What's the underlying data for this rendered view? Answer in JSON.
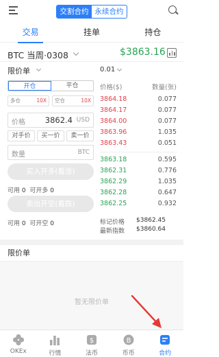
{
  "header": {
    "tab_active": "交割合约",
    "tab_inactive": "永续合约"
  },
  "main_tabs": [
    "交易",
    "挂单",
    "持仓"
  ],
  "instrument": {
    "pair": "BTC 当周·0308",
    "last_price": "$3863.16"
  },
  "order_form": {
    "order_type": "限价单",
    "side_open": "开仓",
    "side_close": "平仓",
    "long_lev_label": "多仓",
    "long_lev_value": "10X",
    "short_lev_label": "空仓",
    "short_lev_value": "10X",
    "price_label": "价格",
    "price_value": "3862.4",
    "price_unit": "USD",
    "quick": [
      "对手价",
      "买一价",
      "卖一价"
    ],
    "qty_label": "数量",
    "qty_unit": "BTC",
    "buy_button": "买入开多(看涨)",
    "sell_button": "卖出开空(看跌)",
    "avail_label": "可用",
    "avail_value": "0",
    "can_long_label": "可开多",
    "can_long_value": "0",
    "can_short_label": "可开空",
    "can_short_value": "0"
  },
  "orderbook": {
    "depth": "0.01",
    "price_header": "价格($)",
    "qty_header": "数量(张)",
    "asks": [
      {
        "price": "3864.18",
        "qty": "0.077"
      },
      {
        "price": "3864.17",
        "qty": "0.077"
      },
      {
        "price": "3864.00",
        "qty": "0.077"
      },
      {
        "price": "3863.96",
        "qty": "1.035"
      },
      {
        "price": "3863.43",
        "qty": "0.051"
      }
    ],
    "bids": [
      {
        "price": "3863.18",
        "qty": "0.595"
      },
      {
        "price": "3862.31",
        "qty": "0.776"
      },
      {
        "price": "3862.29",
        "qty": "1.035"
      },
      {
        "price": "3862.28",
        "qty": "0.647"
      },
      {
        "price": "3862.25",
        "qty": "0.932"
      }
    ],
    "mark_label": "标记价格",
    "mark_value": "$3862.45",
    "index_label": "最新指数",
    "index_value": "$3860.64"
  },
  "limit_section": {
    "title": "限价单",
    "empty": "暂无限价单"
  },
  "bottom_nav": [
    {
      "label": "OKEx",
      "icon": "okex-logo-icon"
    },
    {
      "label": "行情",
      "icon": "bar-chart-icon"
    },
    {
      "label": "法币",
      "icon": "fiat-coin-icon"
    },
    {
      "label": "币币",
      "icon": "bitcoin-icon"
    },
    {
      "label": "合约",
      "icon": "contract-icon"
    }
  ],
  "colors": {
    "accent": "#2c7ff7",
    "up": "#2aa353",
    "down": "#e0424b",
    "annotation": "#e53935"
  }
}
